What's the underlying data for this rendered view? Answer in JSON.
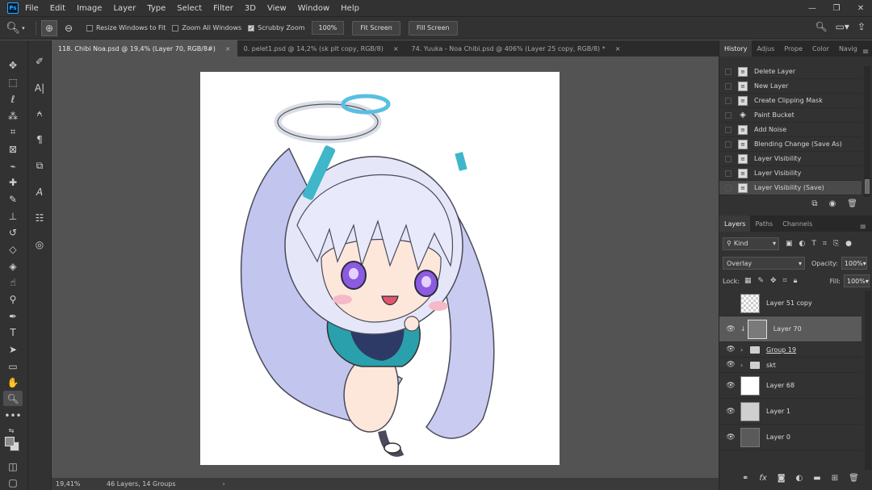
{
  "app": {
    "logo": "Ps"
  },
  "menu": [
    "File",
    "Edit",
    "Image",
    "Layer",
    "Type",
    "Select",
    "Filter",
    "3D",
    "View",
    "Window",
    "Help"
  ],
  "window_controls": {
    "minimize": "—",
    "restore": "❐",
    "close": "✕"
  },
  "options": {
    "resize_windows": "Resize Windows to Fit",
    "zoom_all": "Zoom All Windows",
    "scrubby_zoom": "Scrubby Zoom",
    "zoom_value": "100%",
    "fit_screen": "Fit Screen",
    "fill_screen": "Fill Screen"
  },
  "tabs": [
    {
      "label": "118. Chibi Noa.psd @ 19,4% (Layer 70, RGB/8#)",
      "close": "×"
    },
    {
      "label": "0. pelet1.psd @ 14,2% (sk plt copy, RGB/8)",
      "close": "×"
    },
    {
      "label": "74. Yuuka - Noa Chibi.psd @ 406% (Layer 25 copy, RGB/8) *",
      "close": "×"
    }
  ],
  "status": {
    "zoom": "19,41%",
    "info": "46 Layers, 14 Groups",
    "arrow": "›"
  },
  "panel_tabs_top": [
    "History",
    "Adjus",
    "Prope",
    "Color",
    "Navig"
  ],
  "history": [
    "Delete Layer",
    "New Layer",
    "Create Clipping Mask",
    "Paint Bucket",
    "Add Noise",
    "Blending Change (Save As)",
    "Layer Visibility",
    "Layer Visibility",
    "Layer Visibility (Save)"
  ],
  "panel_tabs_layers": [
    "Layers",
    "Paths",
    "Channels"
  ],
  "layers_panel": {
    "kind": "Kind",
    "blend_mode": "Overlay",
    "opacity_label": "Opacity:",
    "opacity": "100%",
    "lock_label": "Lock:",
    "fill_label": "Fill:",
    "fill": "100%"
  },
  "layers": [
    {
      "name": "Layer 51 copy"
    },
    {
      "name": "Layer 70"
    },
    {
      "name": "Group 19"
    },
    {
      "name": "skt"
    },
    {
      "name": "Layer 68"
    },
    {
      "name": "Layer 1"
    },
    {
      "name": "Layer 0"
    }
  ],
  "colors": {
    "app_bg": "#535353",
    "panel_bg": "#323232",
    "hair": "#dfe3f7",
    "hair_shade": "#b4b8e6",
    "accent_teal": "#3fb6c9",
    "jacket": "#2aa0ad",
    "body_suit": "#2e3a66",
    "skin": "#fde7da",
    "eyes": "#8c5be0"
  }
}
